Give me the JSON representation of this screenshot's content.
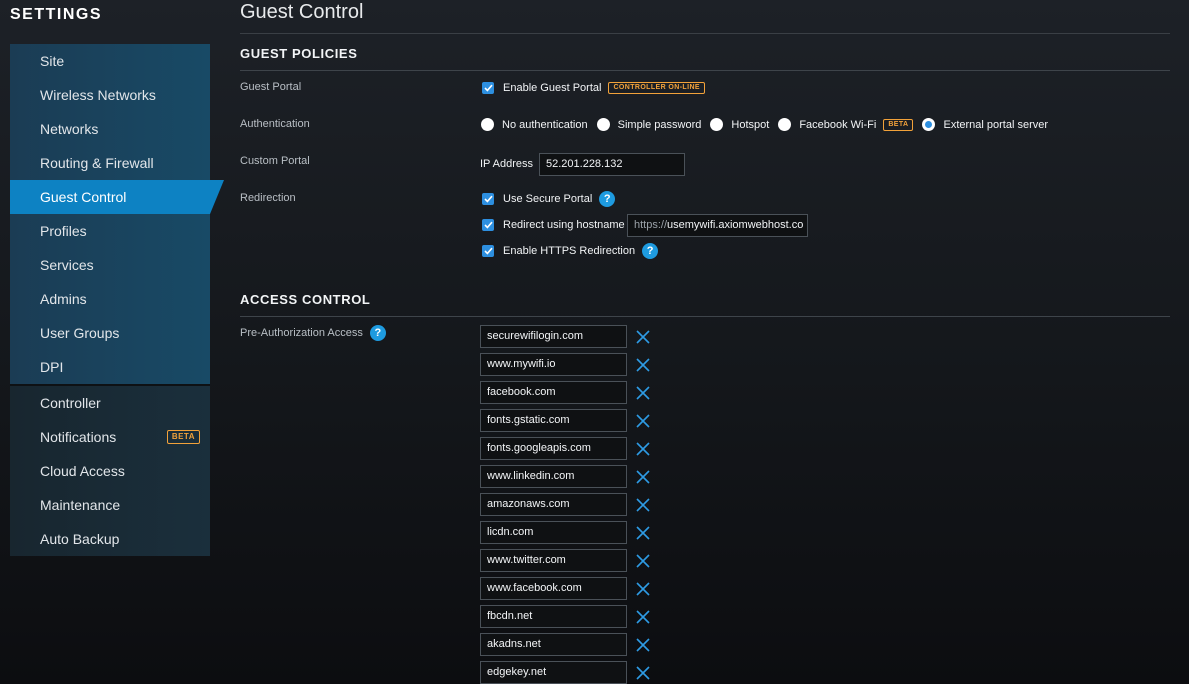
{
  "sidebar": {
    "title": "SETTINGS",
    "items_primary": [
      {
        "label": "Site"
      },
      {
        "label": "Wireless Networks"
      },
      {
        "label": "Networks"
      },
      {
        "label": "Routing & Firewall"
      },
      {
        "label": "Guest Control",
        "active": true
      },
      {
        "label": "Profiles"
      },
      {
        "label": "Services"
      },
      {
        "label": "Admins"
      },
      {
        "label": "User Groups"
      },
      {
        "label": "DPI"
      }
    ],
    "items_secondary": [
      {
        "label": "Controller"
      },
      {
        "label": "Notifications",
        "badge": "BETA"
      },
      {
        "label": "Cloud Access"
      },
      {
        "label": "Maintenance"
      },
      {
        "label": "Auto Backup"
      }
    ]
  },
  "page": {
    "title": "Guest Control"
  },
  "guest_policies": {
    "heading": "GUEST POLICIES",
    "guest_portal": {
      "label": "Guest Portal",
      "checkbox_label": "Enable Guest Portal",
      "checked": true,
      "status_tag": "CONTROLLER ON-LINE"
    },
    "authentication": {
      "label": "Authentication",
      "options": [
        {
          "label": "No authentication",
          "selected": false
        },
        {
          "label": "Simple password",
          "selected": false
        },
        {
          "label": "Hotspot",
          "selected": false
        },
        {
          "label": "Facebook Wi-Fi",
          "selected": false,
          "badge": "BETA"
        },
        {
          "label": "External portal server",
          "selected": true
        }
      ]
    },
    "custom_portal": {
      "label": "Custom Portal",
      "ip_label": "IP Address",
      "ip_value": "52.201.228.132"
    },
    "redirection": {
      "label": "Redirection",
      "use_secure_portal": {
        "label": "Use Secure Portal",
        "checked": true
      },
      "redirect_hostname": {
        "label": "Redirect using hostname",
        "checked": true,
        "prefix": "https://",
        "value": "usemywifi.axiomwebhost.co"
      },
      "https_redirection": {
        "label": "Enable HTTPS Redirection",
        "checked": true
      }
    }
  },
  "access_control": {
    "heading": "ACCESS CONTROL",
    "pre_auth_label": "Pre-Authorization Access",
    "domains": [
      "securewifilogin.com",
      "www.mywifi.io",
      "facebook.com",
      "fonts.gstatic.com",
      "fonts.googleapis.com",
      "www.linkedin.com",
      "amazonaws.com",
      "licdn.com",
      "www.twitter.com",
      "www.facebook.com",
      "fbcdn.net",
      "akadns.net",
      "edgekey.net"
    ]
  },
  "colors": {
    "accent": "#0d82c3",
    "checkbox": "#2d8fe0",
    "badge": "#f2a23a",
    "remove_icon": "#2e9be4"
  },
  "icons": {
    "help": "question-circle-icon",
    "remove": "close-x-icon",
    "check": "checkmark-icon"
  }
}
